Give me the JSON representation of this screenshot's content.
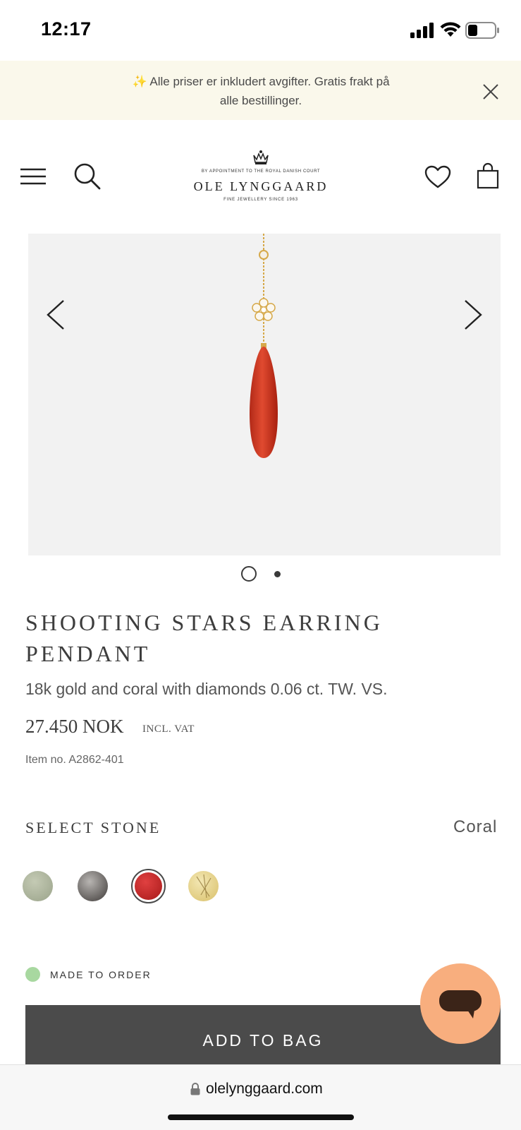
{
  "status_bar": {
    "time": "12:17"
  },
  "banner": {
    "text": "✨ Alle priser er inkludert avgifter. Gratis frakt på alle bestillinger."
  },
  "header": {
    "logo_top": "BY APPOINTMENT TO THE ROYAL DANISH COURT",
    "logo_name": "OLE LYNGGAARD",
    "logo_sub": "FINE JEWELLERY SINCE 1963"
  },
  "gallery": {
    "image_count": 2,
    "active_index": 1
  },
  "product": {
    "title": "SHOOTING STARS EARRING PENDANT",
    "description": "18k gold and coral with diamonds 0.06 ct. TW. VS.",
    "price": "27.450 NOK",
    "price_vat": "INCL. VAT",
    "item_no": "Item no. A2862-401"
  },
  "stone_select": {
    "label": "SELECT STONE",
    "selected": "Coral",
    "swatch_colors": [
      "#a9b198",
      "#55504d",
      "#c42828",
      "#e8d48a"
    ]
  },
  "availability": {
    "text": "MADE TO ORDER",
    "color": "#a8d8a0"
  },
  "actions": {
    "add_to_bag": "ADD TO BAG"
  },
  "browser": {
    "url": "olelynggaard.com"
  }
}
